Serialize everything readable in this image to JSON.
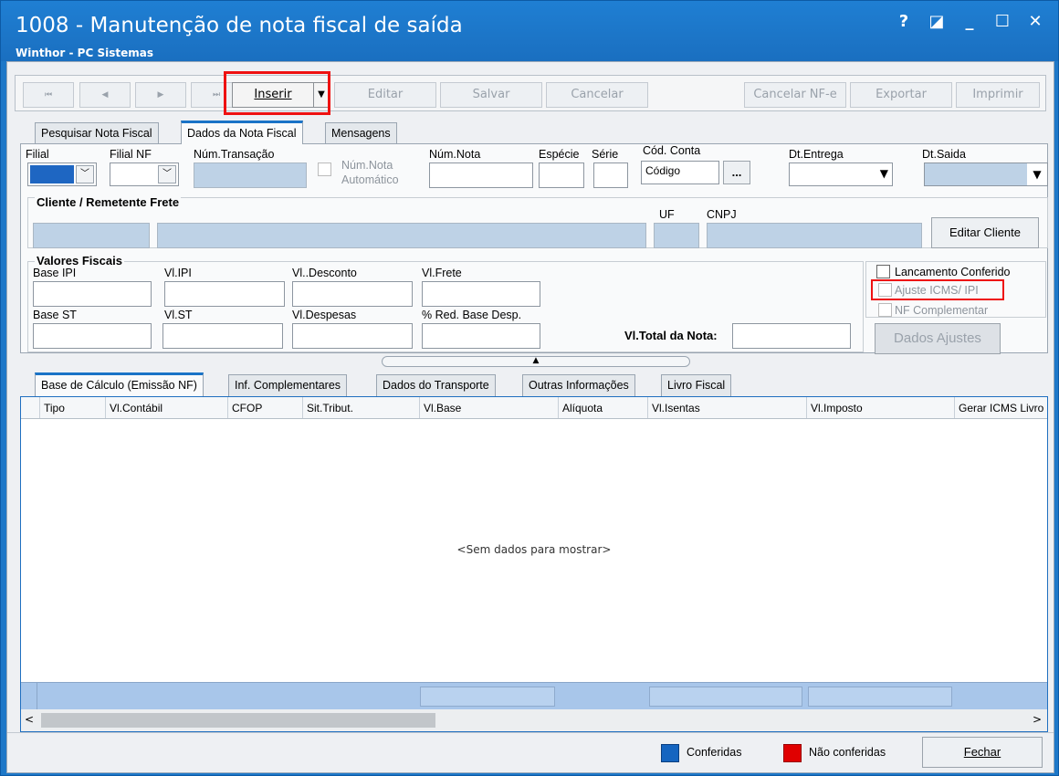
{
  "window": {
    "title": "1008 - Manutenção de nota fiscal de saída",
    "subtitle": "Winthor - PC Sistemas",
    "controls": [
      "?",
      "◪",
      "_",
      "☐",
      "✕"
    ]
  },
  "toolbar": {
    "first": "⏮",
    "prev": "◀",
    "next": "▶",
    "last": "⏭",
    "inserir": "Inserir",
    "editar": "Editar",
    "salvar": "Salvar",
    "cancelar": "Cancelar",
    "cancelar_nfe": "Cancelar NF-e",
    "exportar": "Exportar",
    "imprimir": "Imprimir"
  },
  "tabs": {
    "pesquisar": "Pesquisar Nota Fiscal",
    "dados": "Dados da Nota Fiscal",
    "mensagens": "Mensagens"
  },
  "form": {
    "filial": "Filial",
    "filial_nf": "Filial NF",
    "num_transacao": "Núm.Transação",
    "num_nota_auto_1": "Núm.Nota",
    "num_nota_auto_2": "Automático",
    "num_nota": "Núm.Nota",
    "especie": "Espécie",
    "serie": "Série",
    "cod_conta": "Cód. Conta",
    "cod_conta_placeholder": "Código",
    "ellipsis": "...",
    "dt_entrega": "Dt.Entrega",
    "dt_saida": "Dt.Saida",
    "cliente_group": "Cliente / Remetente Frete",
    "uf": "UF",
    "cnpj": "CNPJ",
    "editar_cliente": "Editar Cliente",
    "valores_group": "Valores Fiscais",
    "base_ipi": "Base IPI",
    "vl_ipi": "Vl.IPI",
    "vl_desconto": "Vl..Desconto",
    "vl_frete": "Vl.Frete",
    "base_st": "Base ST",
    "vl_st": "Vl.ST",
    "vl_despesas": "Vl.Despesas",
    "red_base_desp": "% Red. Base Desp.",
    "vl_total": "Vl.Total da Nota:",
    "lancamento_conferido": "Lancamento Conferido",
    "ajuste_icms": "Ajuste ICMS/ IPI",
    "nf_complementar": "NF Complementar",
    "dados_ajustes": "Dados Ajustes"
  },
  "lower_tabs": [
    "Base de Cálculo (Emissão NF)",
    "Inf. Complementares",
    "Dados do Transporte",
    "Outras Informações",
    "Livro Fiscal"
  ],
  "grid": {
    "columns": [
      "Tipo",
      "Vl.Contábil",
      "CFOP",
      "Sit.Tribut.",
      "Vl.Base",
      "Alíquota",
      "Vl.Isentas",
      "Vl.Imposto",
      "Gerar ICMS Livro"
    ],
    "empty_text": "<Sem dados para mostrar>"
  },
  "status": {
    "conferidas": "Conferidas",
    "nao_conferidas": "Não conferidas",
    "fechar": "Fechar"
  },
  "colors": {
    "title_bar": "#1a73c7",
    "conferidas": "#1565c0",
    "nao_conferidas": "#e00000",
    "highlight": "#ee1111"
  }
}
